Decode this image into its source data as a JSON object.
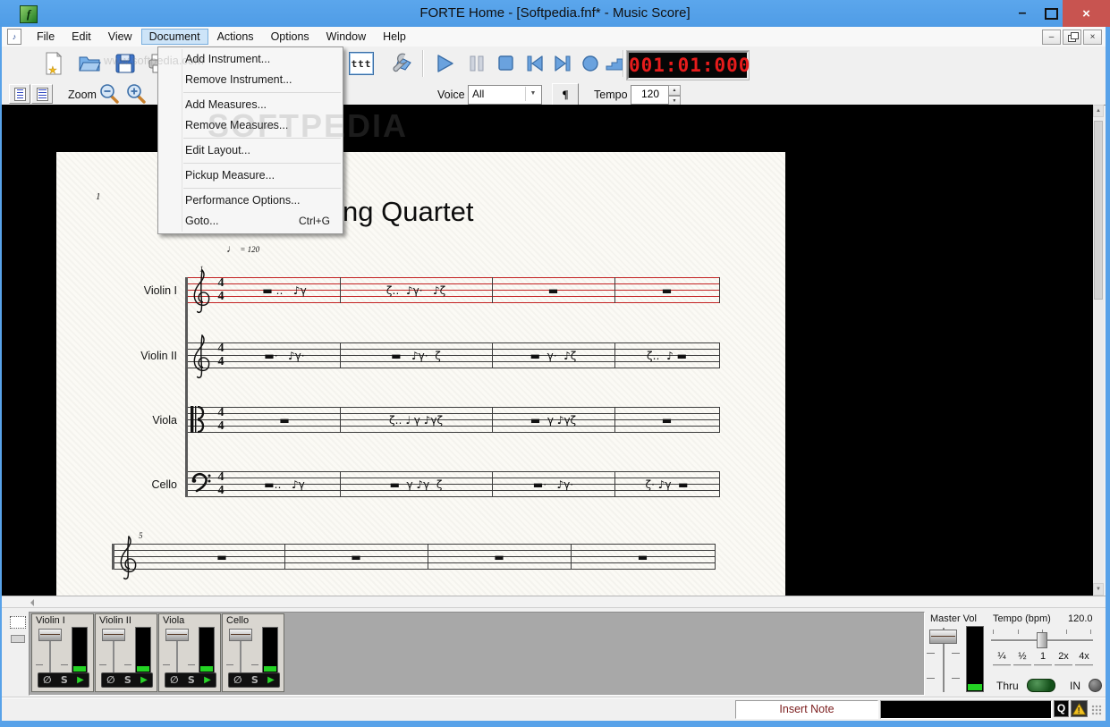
{
  "window": {
    "title": "FORTE Home - [Softpedia.fnf* - Music Score]",
    "minimize_glyph": "–",
    "close_glyph": "×",
    "logo_glyph": "f"
  },
  "watermark": {
    "big": "SOFTPEDIA",
    "small": "www.softpedia.com"
  },
  "menubar": {
    "items": [
      "File",
      "Edit",
      "View",
      "Document",
      "Actions",
      "Options",
      "Window",
      "Help"
    ],
    "active_index": 3
  },
  "document_menu": {
    "items": [
      {
        "label": "Add Instrument..."
      },
      {
        "label": "Remove Instrument...",
        "separator_after": true
      },
      {
        "label": "Add Measures..."
      },
      {
        "label": "Remove Measures...",
        "separator_after": true
      },
      {
        "label": "Edit Layout...",
        "separator_after": true
      },
      {
        "label": "Pickup Measure...",
        "separator_after": true
      },
      {
        "label": "Performance Options..."
      },
      {
        "label": "Goto...",
        "shortcut": "Ctrl+G"
      }
    ]
  },
  "toolbar": {
    "timecode": "001:01:000",
    "mixer_icon_text": "ttt"
  },
  "toolbar2": {
    "zoom_label": "Zoom",
    "voice_label": "Voice",
    "voice_value": "All",
    "paragraph_button": "¶",
    "tempo_label": "Tempo",
    "tempo_value": "120"
  },
  "score": {
    "page_number": "1",
    "title": "String Quartet",
    "tempo_note": "♩",
    "tempo_equals": "= 120",
    "system1": {
      "measure_number": "1",
      "staves": [
        {
          "label": "Violin I",
          "clef": "treble",
          "time": "4/4",
          "red": true,
          "measures": [
            "▬ ‥   ♪γ",
            "ζ‥  ♪γ·   ♪ζ",
            "▬",
            "▬"
          ]
        },
        {
          "label": "Violin II",
          "clef": "treble",
          "time": "4/4",
          "red": false,
          "measures": [
            "▬·   ♪γ·",
            "▬   ♪γ·  ζ",
            "▬  γ·  ♪ζ",
            "ζ‥  ♪ ▬"
          ]
        },
        {
          "label": "Viola",
          "clef": "alto",
          "time": "4/4",
          "red": false,
          "measures": [
            "▬",
            "ζ‥ ♩ γ ♪γζ",
            "▬  γ ♪γζ",
            "▬"
          ]
        },
        {
          "label": "Cello",
          "clef": "bass",
          "time": "4/4",
          "red": false,
          "measures": [
            "▬‥   ♪γ",
            "▬  γ ♪γ  ζ",
            "▬·   ♪γ·",
            "ζ· ♪γ  ▬"
          ]
        }
      ]
    },
    "system2": {
      "measure_number": "5",
      "clef": "treble",
      "measures": [
        "▬",
        "▬",
        "▬",
        "▬"
      ]
    }
  },
  "mixer": {
    "channels": [
      {
        "name": "Violin I"
      },
      {
        "name": "Violin II"
      },
      {
        "name": "Viola"
      },
      {
        "name": "Cello"
      }
    ],
    "mute_label": "∅",
    "solo_label": "S",
    "play_label": "▶",
    "master_label": "Master Vol",
    "tempo_label": "Tempo (bpm)",
    "tempo_value": "120.0",
    "rate_buttons": [
      "¼",
      "½",
      "1",
      "2x",
      "4x"
    ],
    "thru_label": "Thru",
    "in_label": "IN"
  },
  "statusbar": {
    "mode": "Insert Note",
    "quantize_label": "Q",
    "warning_glyph": "!"
  }
}
